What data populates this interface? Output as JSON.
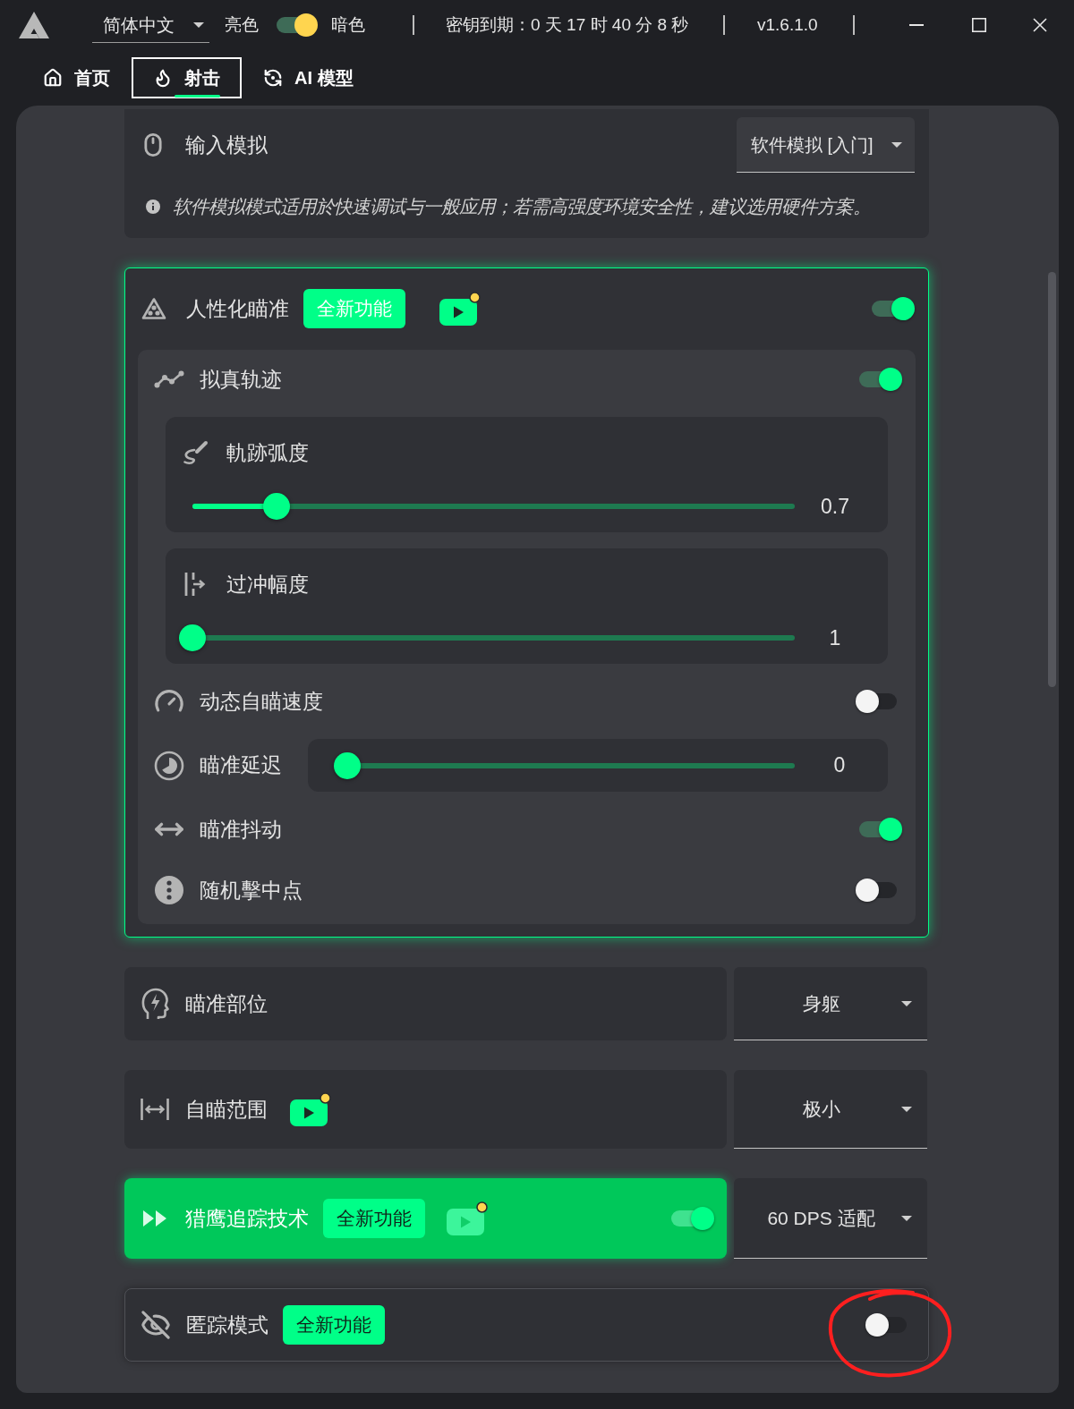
{
  "title_bar": {
    "language": "简体中文",
    "light_label": "亮色",
    "theme_switch_on": true,
    "dark_label": "暗色",
    "key_expiry": "密钥到期：0 天 17 时 40 分 8 秒",
    "version": "v1.6.1.0"
  },
  "tabs": [
    {
      "label": "首页",
      "selected": false
    },
    {
      "label": "射击",
      "selected": true
    },
    {
      "label": "AI 模型",
      "selected": false
    }
  ],
  "input_simulation": {
    "label": "输入模拟",
    "value": "软件模拟 [入门]",
    "note": "软件模拟模式适用於快速调试与一般应用；若需高强度环境安全性，建议选用硬件方案。"
  },
  "humanized_aim": {
    "label": "人性化瞄准",
    "badge": "全新功能",
    "video": true,
    "on": true,
    "items": [
      {
        "kind": "toggle",
        "label": "拟真轨迹",
        "on": true,
        "sliders": [
          {
            "label": "軌跡弧度",
            "level": 0.14,
            "reading": "0.7"
          },
          {
            "label": "过冲幅度",
            "level": 0,
            "reading": "1"
          }
        ]
      },
      {
        "kind": "toggle",
        "label": "动态自瞄速度",
        "on": false
      },
      {
        "kind": "slider",
        "label": "瞄准延迟",
        "level": 0,
        "reading": "0"
      },
      {
        "kind": "toggle",
        "label": "瞄准抖动",
        "on": true
      },
      {
        "kind": "toggle",
        "label": "随机擊中点",
        "on": false
      }
    ]
  },
  "settings_rows": [
    {
      "kind": "select",
      "label": "瞄准部位",
      "value": "身躯"
    },
    {
      "kind": "select",
      "label": "自瞄范围",
      "video": true,
      "value": "极小"
    },
    {
      "kind": "select",
      "label": "猎鹰追踪技术",
      "badge": "全新功能",
      "video": true,
      "on": true,
      "value": "60 DPS 适配"
    },
    {
      "kind": "toggle",
      "label": "匿踪模式",
      "badge": "全新功能",
      "on": false,
      "annotated": true
    }
  ]
}
